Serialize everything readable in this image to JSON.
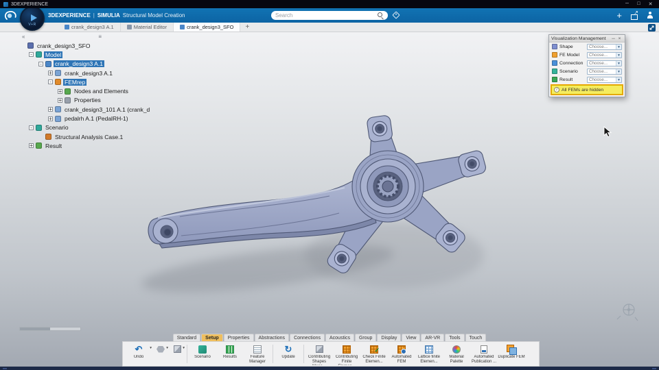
{
  "window": {
    "title": "3DEXPERIENCE",
    "minimize": "─",
    "maximize": "□",
    "close": "✕"
  },
  "header": {
    "brand": "3DEXPERIENCE",
    "pipe": "|",
    "app_brand": "SIMULIA",
    "app_title": "Structural Model Creation",
    "search_placeholder": "Search",
    "add_label": "+",
    "compass_label": "V+R"
  },
  "tab_bar": {
    "tabs": [
      {
        "label": "crank_design3 A.1",
        "active": false
      },
      {
        "label": "Material Editor",
        "active": false
      },
      {
        "label": "crank_design3_SFO",
        "active": true
      }
    ],
    "add_label": "+"
  },
  "tree": {
    "items": [
      {
        "label": "crank_design3_SFO",
        "exp": "",
        "selected": false
      },
      {
        "label": "Model",
        "exp": "-",
        "selected": true
      },
      {
        "label": "crank_design3 A.1",
        "exp": "-",
        "selected": true
      },
      {
        "label": "crank_design3 A.1",
        "exp": "+",
        "selected": false
      },
      {
        "label": "FEMrep",
        "exp": "-",
        "selected": true
      },
      {
        "label": "Nodes and Elements",
        "exp": "+",
        "selected": false
      },
      {
        "label": "Properties",
        "exp": "+",
        "selected": false
      },
      {
        "label": "crank_design3_101 A.1 (crank_d",
        "exp": "+",
        "selected": false
      },
      {
        "label": "pedalrh A.1 (PedalRH-1)",
        "exp": "+",
        "selected": false
      },
      {
        "label": "Scenario",
        "exp": "-",
        "selected": false
      },
      {
        "label": "Structural Analysis Case.1",
        "exp": "",
        "selected": false
      },
      {
        "label": "Result",
        "exp": "+",
        "selected": false
      }
    ]
  },
  "viz_panel": {
    "title": "Visualization Management",
    "minimize": "─",
    "close": "×",
    "rows": [
      {
        "label": "Shape",
        "value": "Choose..."
      },
      {
        "label": "FE Model",
        "value": "Choose..."
      },
      {
        "label": "Connection",
        "value": "Choose..."
      },
      {
        "label": "Scenario",
        "value": "Choose..."
      },
      {
        "label": "Result",
        "value": "Choose..."
      }
    ],
    "message": "All FEMs are hidden"
  },
  "ribbon": {
    "tabs": [
      "Standard",
      "Setup",
      "Properties",
      "Abstractions",
      "Connections",
      "Acoustics",
      "Group",
      "Display",
      "View",
      "AR-VR",
      "Tools",
      "Touch"
    ],
    "active_tab": "Setup",
    "tools": [
      {
        "label": "Undo",
        "icon": "undo-icon"
      },
      {
        "label": "",
        "icon": "hexagon-icon"
      },
      {
        "label": "",
        "icon": "cube-icon"
      },
      {
        "label": "Scenario",
        "icon": "scenario-icon"
      },
      {
        "label": "Results",
        "icon": "results-icon"
      },
      {
        "label": "Feature Manager",
        "icon": "feature-manager-icon"
      },
      {
        "label": "Update",
        "icon": "update-icon"
      },
      {
        "label": "Contributing Shapes Mana...",
        "icon": "contributing-shapes-icon"
      },
      {
        "label": "Contributing Finite Elemen...",
        "icon": "contributing-fe-icon"
      },
      {
        "label": "Check Finite Elemen...",
        "icon": "check-fe-icon"
      },
      {
        "label": "Automated FEM",
        "icon": "automated-fem-icon"
      },
      {
        "label": "Lattice finite Elemen...",
        "icon": "lattice-fe-icon"
      },
      {
        "label": "Material Palette",
        "icon": "material-palette-icon"
      },
      {
        "label": "Automated Publication ...",
        "icon": "automated-publication-icon"
      },
      {
        "label": "Duplicate FEM",
        "icon": "duplicate-fem-icon"
      }
    ]
  },
  "colors": {
    "header_blue": "#0e6cae",
    "selection_blue": "#2e75b6",
    "active_tab_amber": "#efbf5e",
    "warning_yellow": "#f5ec5e",
    "model_body": "#9aa4c5"
  }
}
